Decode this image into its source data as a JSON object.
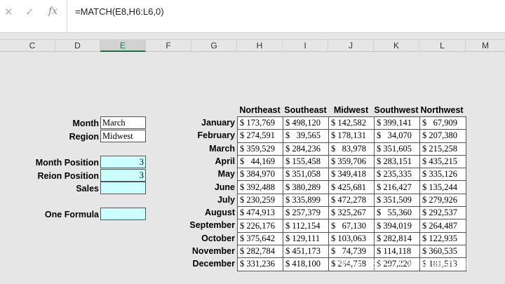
{
  "formula_bar": {
    "cancel_icon": "x-icon",
    "enter_icon": "check-icon",
    "fx_label": "fx",
    "formula": "=MATCH(E8,H6:L6,0)"
  },
  "columns": [
    "C",
    "D",
    "E",
    "F",
    "G",
    "H",
    "I",
    "J",
    "K",
    "L",
    "M"
  ],
  "selected_column": "E",
  "inputs": {
    "month_label": "Month",
    "month_value": "March",
    "region_label": "Region",
    "region_value": "Midwest",
    "month_position_label": "Month Position",
    "month_position_value": "3",
    "region_position_label": "Reion Position",
    "region_position_value": "3",
    "sales_label": "Sales",
    "sales_value": "",
    "one_formula_label": "One Formula",
    "one_formula_value": ""
  },
  "table": {
    "headers": [
      "Northeast",
      "Southeast",
      "Midwest",
      "Southwest",
      "Northwest"
    ],
    "rows": [
      {
        "month": "January",
        "values": [
          "$ 173,769",
          "$ 498,120",
          "$ 142,582",
          "$ 399,141",
          "$   67,909"
        ]
      },
      {
        "month": "February",
        "values": [
          "$ 274,591",
          "$   39,565",
          "$ 178,131",
          "$   34,070",
          "$ 207,380"
        ]
      },
      {
        "month": "March",
        "values": [
          "$ 359,529",
          "$ 284,236",
          "$   83,978",
          "$ 351,605",
          "$ 215,258"
        ]
      },
      {
        "month": "April",
        "values": [
          "$   44,169",
          "$ 155,458",
          "$ 359,706",
          "$ 283,151",
          "$ 435,215"
        ]
      },
      {
        "month": "May",
        "values": [
          "$ 384,970",
          "$ 351,058",
          "$ 349,418",
          "$ 235,335",
          "$ 335,126"
        ]
      },
      {
        "month": "June",
        "values": [
          "$ 392,488",
          "$ 380,289",
          "$ 425,681",
          "$ 216,427",
          "$ 135,244"
        ]
      },
      {
        "month": "July",
        "values": [
          "$ 230,259",
          "$ 335,899",
          "$ 472,278",
          "$ 351,509",
          "$ 279,926"
        ]
      },
      {
        "month": "August",
        "values": [
          "$ 474,913",
          "$ 257,379",
          "$ 325,267",
          "$   55,360",
          "$ 292,537"
        ]
      },
      {
        "month": "September",
        "values": [
          "$ 226,176",
          "$ 112,154",
          "$   67,130",
          "$ 394,019",
          "$ 264,487"
        ]
      },
      {
        "month": "October",
        "values": [
          "$ 375,642",
          "$ 129,111",
          "$ 103,063",
          "$ 282,814",
          "$ 122,935"
        ]
      },
      {
        "month": "November",
        "values": [
          "$ 282,784",
          "$ 451,173",
          "$   74,739",
          "$ 114,118",
          "$ 360,535"
        ]
      },
      {
        "month": "December",
        "values": [
          "$ 331,236",
          "$ 418,100",
          "$ 264,758",
          "$ 297,220",
          "$ 181,513"
        ]
      }
    ]
  },
  "watermark": "知乎 @三十躲用卷吞吴",
  "colors": {
    "input_fill": "#ccffff",
    "selected_column": "#217346"
  }
}
